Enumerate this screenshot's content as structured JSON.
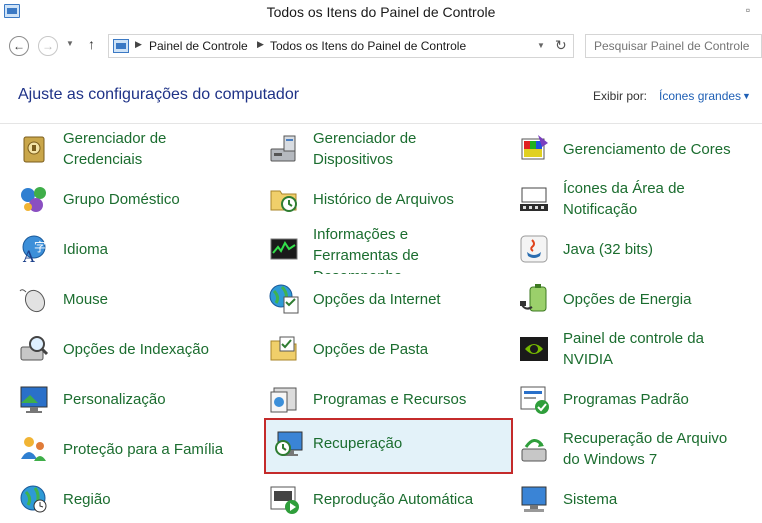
{
  "window": {
    "title": "Todos os Itens do Painel de Controle"
  },
  "nav": {
    "breadcrumbs": [
      "Painel de Controle",
      "Todos os Itens do Painel de Controle"
    ],
    "search_placeholder": "Pesquisar Painel de Controle"
  },
  "header": {
    "title": "Ajuste as configurações do computador",
    "view_by_label": "Exibir por:",
    "view_by_value": "Ícones grandes"
  },
  "items": [
    {
      "label": "Gerenciador de Credenciais",
      "icon": "credential-manager-icon"
    },
    {
      "label": "Gerenciador de Dispositivos",
      "icon": "device-manager-icon"
    },
    {
      "label": "Gerenciamento de Cores",
      "icon": "color-management-icon"
    },
    {
      "label": "Grupo Doméstico",
      "icon": "homegroup-icon"
    },
    {
      "label": "Histórico de Arquivos",
      "icon": "file-history-icon"
    },
    {
      "label": "Ícones da Área de Notificação",
      "icon": "notification-area-icon"
    },
    {
      "label": "Idioma",
      "icon": "language-icon"
    },
    {
      "label": "Informações e Ferramentas de Desempenho",
      "icon": "performance-icon"
    },
    {
      "label": "Java (32 bits)",
      "icon": "java-icon"
    },
    {
      "label": "Mouse",
      "icon": "mouse-icon"
    },
    {
      "label": "Opções da Internet",
      "icon": "internet-options-icon"
    },
    {
      "label": "Opções de Energia",
      "icon": "power-options-icon"
    },
    {
      "label": "Opções de Indexação",
      "icon": "indexing-options-icon"
    },
    {
      "label": "Opções de Pasta",
      "icon": "folder-options-icon"
    },
    {
      "label": "Painel de controle da NVIDIA",
      "icon": "nvidia-icon"
    },
    {
      "label": "Personalização",
      "icon": "personalization-icon"
    },
    {
      "label": "Programas e Recursos",
      "icon": "programs-features-icon"
    },
    {
      "label": "Programas Padrão",
      "icon": "default-programs-icon"
    },
    {
      "label": "Proteção para a Família",
      "icon": "family-safety-icon"
    },
    {
      "label": "Recuperação",
      "icon": "recovery-icon"
    },
    {
      "label": "Recuperação de Arquivo do Windows 7",
      "icon": "windows7-file-recovery-icon"
    },
    {
      "label": "Região",
      "icon": "region-icon"
    },
    {
      "label": "Reprodução Automática",
      "icon": "autoplay-icon"
    },
    {
      "label": "Sistema",
      "icon": "system-icon"
    }
  ],
  "colors": {
    "item_text": "#1b6d2f",
    "title_text": "#1e3287",
    "link_blue": "#1e5fb5",
    "selection_border": "#c42b2b",
    "selection_fill": "#e3f2f9"
  }
}
